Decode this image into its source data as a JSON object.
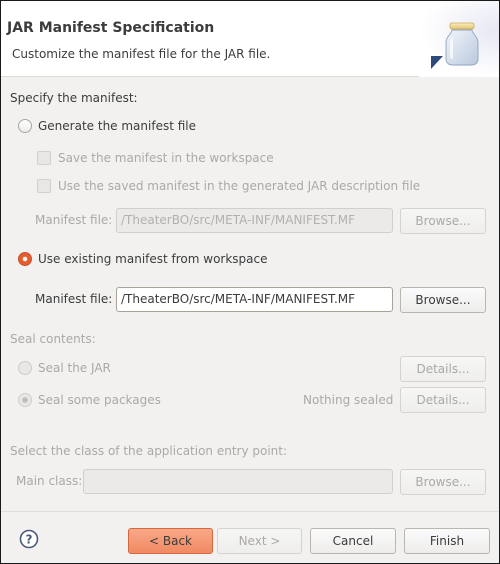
{
  "header": {
    "title": "JAR Manifest Specification",
    "description": "Customize the manifest file for the JAR file.",
    "icon": "jar-icon"
  },
  "manifest": {
    "section_label": "Specify the manifest:",
    "generate_option": {
      "label": "Generate the manifest file",
      "checked": false,
      "enabled": true
    },
    "save_in_workspace": {
      "label": "Save the manifest in the workspace",
      "checked": false,
      "enabled": false
    },
    "use_saved": {
      "label": "Use the saved manifest in the generated JAR description file",
      "checked": false,
      "enabled": false
    },
    "generated_file": {
      "label": "Manifest file:",
      "value": "/TheaterBO/src/META-INF/MANIFEST.MF",
      "enabled": false,
      "browse_label": "Browse..."
    },
    "existing_option": {
      "label": "Use existing manifest from workspace",
      "checked": true,
      "enabled": true
    },
    "existing_file": {
      "label": "Manifest file:",
      "value": "/TheaterBO/src/META-INF/MANIFEST.MF",
      "enabled": true,
      "browse_label": "Browse..."
    }
  },
  "seal": {
    "section_label": "Seal contents:",
    "seal_jar": {
      "label": "Seal the JAR",
      "checked": false,
      "enabled": false,
      "details_label": "Details..."
    },
    "seal_packages": {
      "label": "Seal some packages",
      "checked": true,
      "enabled": false,
      "status": "Nothing sealed",
      "details_label": "Details..."
    }
  },
  "entry_point": {
    "section_label": "Select the class of the application entry point:",
    "main_class": {
      "label": "Main class:",
      "value": "",
      "enabled": false,
      "browse_label": "Browse..."
    }
  },
  "footer": {
    "help_icon": "help-icon",
    "back_label": "< Back",
    "next_label": "Next >",
    "cancel_label": "Cancel",
    "finish_label": "Finish"
  },
  "colors": {
    "accent": "#f08a63",
    "radio_selected": "#e55c2e",
    "background": "#f2f1f0",
    "header_bg": "#ffffff"
  }
}
